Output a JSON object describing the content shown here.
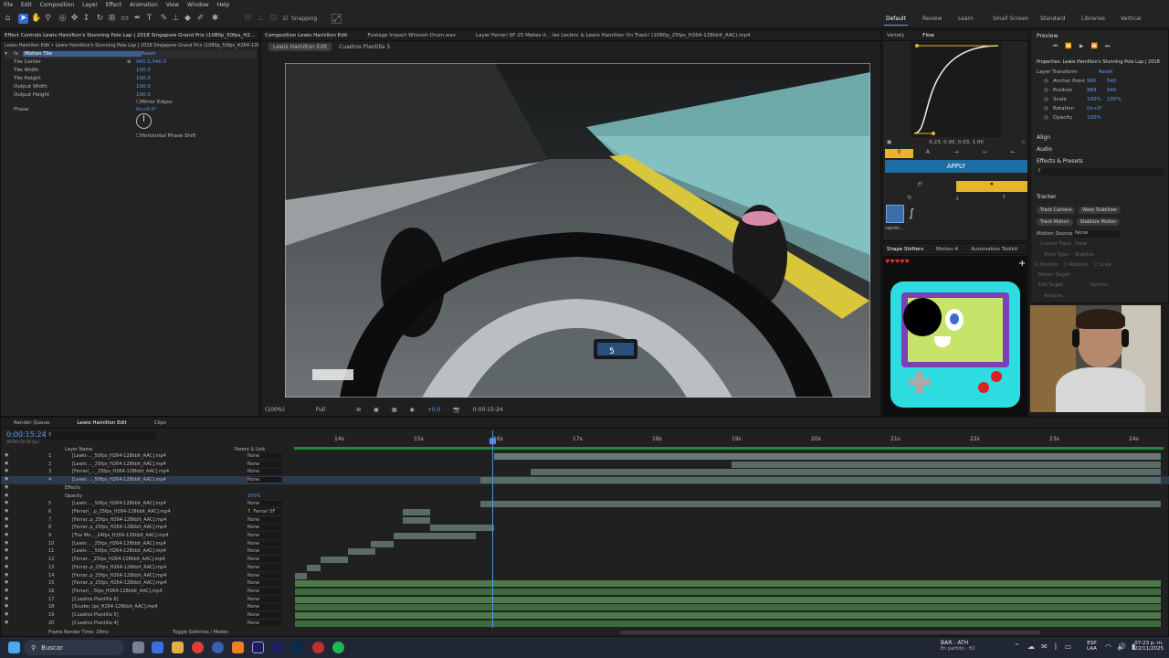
{
  "menu": [
    "File",
    "Edit",
    "Composition",
    "Layer",
    "Effect",
    "Animation",
    "View",
    "Window",
    "Help"
  ],
  "toolbar": {
    "snapping": "Snapping"
  },
  "workspaces": [
    "Default",
    "Review",
    "Learn",
    "Small Screen",
    "Standard",
    "Libraries",
    "Vertical"
  ],
  "effect_controls": {
    "tab": "Effect Controls Lewis Hamilton's Stunning Pole Lap | 2018 Singapore Grand Prix (1080p_50fps_H2...",
    "subtitle": "Lewis Hamilton Edit • Lewis Hamilton's Stunning Pole Lap | 2018 Singapore Grand Prix (1080p_50fps_H264-128kbit",
    "effect": "Motion Tile",
    "reset": "Reset",
    "props": [
      {
        "name": "Tile Center",
        "value": "960.0,540.0"
      },
      {
        "name": "Tile Width",
        "value": "100.0"
      },
      {
        "name": "Tile Height",
        "value": "100.0"
      },
      {
        "name": "Output Width",
        "value": "100.0"
      },
      {
        "name": "Output Height",
        "value": "100.0"
      }
    ],
    "mirror": "Mirror Edges",
    "phase": "Phase",
    "phase_value": "0x+0.0°",
    "hshift": "Horizontal Phase Shift"
  },
  "comp": {
    "tabs": [
      "Composition Lewis Hamilton Edit",
      "Footage Impact Whoosh Drum.wav",
      "Layer Ferrari SF-25 Makes it... les Leclerc & Lewis Hamilton On Track! (1080p_25fps_H264-128kbit_AAC).mp4"
    ],
    "subtabs": [
      "Lewis Hamilton Edit",
      "Cuadros Plantilla 5"
    ],
    "zoom": "(100%)",
    "quality": "Full",
    "time": "0:00:15:24",
    "exposure": "+0.0"
  },
  "flow": {
    "tabs": [
      "Variety",
      "Flow"
    ],
    "curve": "0.23, 0.00, 0.03, 1.00",
    "apply": "APPLY",
    "preset": "rapido..."
  },
  "shape": {
    "tabs": [
      "Shape Shifters",
      "Motion-4",
      "Automation Toolkit"
    ]
  },
  "preview": {
    "title": "Preview",
    "props_title": "Properties: Lewis Hamilton's Stunning Pole Lap | 2018",
    "layer_transform": "Layer Transform",
    "reset": "Reset",
    "props": [
      {
        "name": "Anchor Point",
        "v1": "960",
        "v2": "540"
      },
      {
        "name": "Position",
        "v1": "989",
        "v2": "540"
      },
      {
        "name": "Scale",
        "v1": "100%",
        "v2": "100%"
      },
      {
        "name": "Rotation",
        "v1": "0x+0°",
        "v2": ""
      },
      {
        "name": "Opacity",
        "v1": "100%",
        "v2": ""
      }
    ],
    "align": "Align",
    "audio": "Audio",
    "effects": "Effects & Presets",
    "tracker": "Tracker",
    "track_buttons": [
      "Track Camera",
      "Warp Stabilizer",
      "Track Motion",
      "Stabilize Motion"
    ],
    "motion_source": "Motion Source:",
    "motion_source_value": "None",
    "current_track": "Current Track:",
    "current_track_value": "None",
    "track_type": "Track Type:",
    "track_type_value": "Stabilize",
    "checks": [
      "Position",
      "Rotation",
      "Scale"
    ],
    "motion_target": "Motion Target:",
    "edit_target": "Edit Target...",
    "options": "Options...",
    "analyze": "Analyze:"
  },
  "timeline": {
    "tabs": [
      "Render Queue",
      "Lewis Hamilton Edit",
      "Clips"
    ],
    "timecode": "0:00:15:24",
    "frames": "00799 (50.00 fps)",
    "headers": {
      "layer_name": "Layer Name",
      "parent": "Parent & Link"
    },
    "ruler": [
      "14s",
      "15s",
      "16s",
      "17s",
      "18s",
      "19s",
      "20s",
      "21s",
      "22s",
      "23s",
      "24s"
    ],
    "layers": [
      {
        "num": "1",
        "name": "[Lewis ..._50fps_H264-128kbit_AAC].mp4",
        "parent": "None"
      },
      {
        "num": "2",
        "name": "[Lewis ..._25fps_H264-128kbit_AAC].mp4",
        "parent": "None"
      },
      {
        "num": "3",
        "name": "[Ferrari_..._25fps_H264-128kbit_AAC].mp4",
        "parent": "None"
      },
      {
        "num": "4",
        "name": "[Lewis ..._50fps_H264-128kbit_AAC].mp4",
        "parent": "None"
      },
      {
        "num": "",
        "name": "Effects",
        "parent": ""
      },
      {
        "num": "",
        "name": "Opacity",
        "parent": "100%"
      },
      {
        "num": "5",
        "name": "[Lewis ..._50fps_H264-128kbit_AAC].mp4",
        "parent": "None"
      },
      {
        "num": "6",
        "name": "[Ferrari_..p_25fps_H264-128kbit_AAC].mp4",
        "parent": "7. Ferrari SF"
      },
      {
        "num": "7",
        "name": "[Ferrar..p_25fps_H264-128kbit_AAC].mp4",
        "parent": "None"
      },
      {
        "num": "8",
        "name": "[Ferrar..p_25fps_H264-128kbit_AAC].mp4",
        "parent": "None"
      },
      {
        "num": "9",
        "name": "[The Mo..._24fps_H264-128kbit_AAC].mp4",
        "parent": "None"
      },
      {
        "num": "10",
        "name": "[Lewis ..._25fps_H264-128kbit_AAC].mp4",
        "parent": "None"
      },
      {
        "num": "11",
        "name": "[Lewis ..._50fps_H264-128kbit_AAC].mp4",
        "parent": "None"
      },
      {
        "num": "12",
        "name": "[Ferrar..._25fps_H264-128kbit_AAC].mp4",
        "parent": "None"
      },
      {
        "num": "13",
        "name": "[Ferrar..p_25fps_H264-128kbit_AAC].mp4",
        "parent": "None"
      },
      {
        "num": "14",
        "name": "[Ferrar..p_25fps_H264-128kbit_AAC].mp4",
        "parent": "None"
      },
      {
        "num": "15",
        "name": "[Ferrar..p_25fps_H264-128kbit_AAC].mp4",
        "parent": "None"
      },
      {
        "num": "16",
        "name": "[Ferrari_..5fps_H264-128kbit_AAC].mp4",
        "parent": "None"
      },
      {
        "num": "17",
        "name": "[Cuadros Plantilla 6]",
        "parent": "None"
      },
      {
        "num": "18",
        "name": "[Scuder..lps_H264-128kbit_AAC].mp4",
        "parent": "None"
      },
      {
        "num": "19",
        "name": "[Cuadros Plantilla 5]",
        "parent": "None"
      },
      {
        "num": "20",
        "name": "[Cuadros Plantilla 4]",
        "parent": "None"
      }
    ],
    "footer": "Frame Render Time: 18ms",
    "toggle": "Toggle Switches / Modes"
  },
  "taskbar": {
    "search": "Buscar",
    "match": "BAR - ATH",
    "match_status": "En partido · H2",
    "lang1": "ESP",
    "lang2": "LAA",
    "time": "07:23 p. m.",
    "date": "22/11/2025"
  }
}
